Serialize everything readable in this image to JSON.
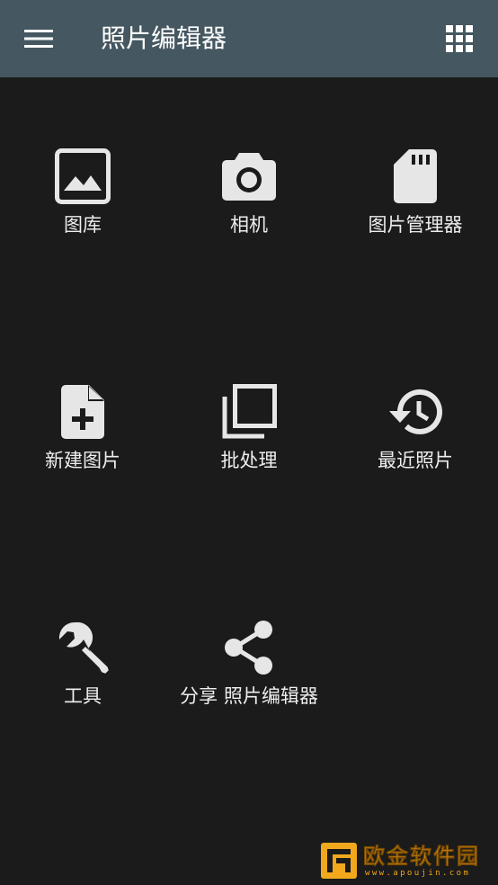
{
  "appbar": {
    "title": "照片编辑器",
    "menu_icon": "hamburger-menu-icon",
    "apps_icon": "apps-grid-icon",
    "background": "#455760"
  },
  "tiles": [
    {
      "label": "图库",
      "icon": "image-icon"
    },
    {
      "label": "相机",
      "icon": "camera-icon"
    },
    {
      "label": "图片管理器",
      "icon": "sd-card-icon"
    },
    {
      "label": "新建图片",
      "icon": "new-file-icon"
    },
    {
      "label": "批处理",
      "icon": "library-stack-icon"
    },
    {
      "label": "最近照片",
      "icon": "history-icon"
    },
    {
      "label": "工具",
      "icon": "wrench-icon"
    },
    {
      "label": "分享 照片编辑器",
      "icon": "share-icon"
    }
  ],
  "watermark": {
    "text": "欧金软件园",
    "sub": "www.apoujin.com",
    "color": "#f2a81d"
  },
  "colors": {
    "background": "#1b1b1b",
    "icon": "#e6e6e6",
    "text": "#eeeeee"
  }
}
